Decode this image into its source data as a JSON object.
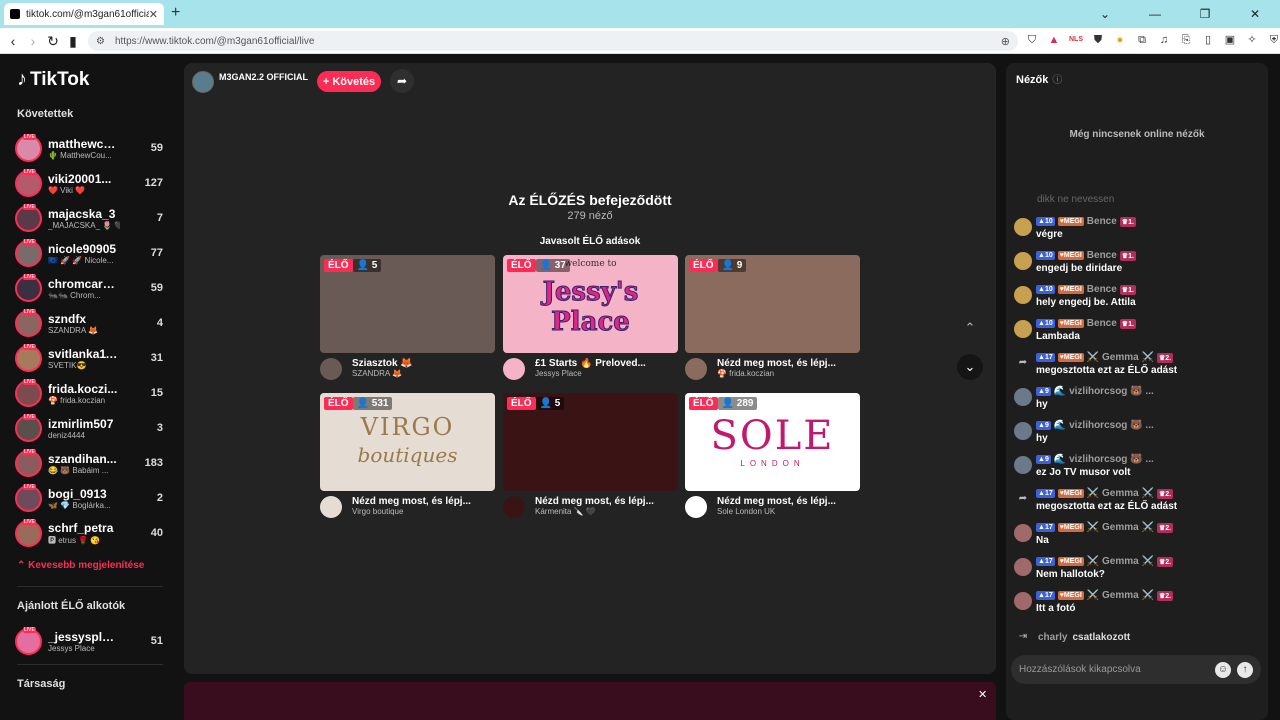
{
  "browser": {
    "tab_title": "tiktok.com/@m3gan61official/li...",
    "url": "https://www.tiktok.com/@m3gan61official/live"
  },
  "brand": {
    "name": "TikTok"
  },
  "sidebar": {
    "following_title": "Követettek",
    "accounts": [
      {
        "name": "matthewco...",
        "sub": "🌵 MatthewCou...",
        "count": "59"
      },
      {
        "name": "viki20001...",
        "sub": "❤️ Viki ❤️",
        "count": "127"
      },
      {
        "name": "majacska_3",
        "sub": "_MAJACSKA_ 🌷 🖤",
        "count": "7"
      },
      {
        "name": "nicole90905",
        "sub": "🇪🇺 🚀 🚀 Nicole...",
        "count": "77"
      },
      {
        "name": "chromcarb...",
        "sub": "🐜🐜 Chrom...",
        "count": "59"
      },
      {
        "name": "szndfx",
        "sub": "SZANDRA 🦊",
        "count": "4"
      },
      {
        "name": "svitlanka11...",
        "sub": "SVETIK😎",
        "count": "31"
      },
      {
        "name": "frida.koczi...",
        "sub": "🍄 frida.koczian",
        "count": "15"
      },
      {
        "name": "izmirlim507",
        "sub": "deniz4444",
        "count": "3"
      },
      {
        "name": "szandihan...",
        "sub": "😂 🐻 Babáim ...",
        "count": "183"
      },
      {
        "name": "bogi_0913",
        "sub": "🦋 💎 Boglárka...",
        "count": "2"
      },
      {
        "name": "schrf_petra",
        "sub": "🅿 etrus 🌹 😘",
        "count": "40"
      }
    ],
    "show_less": "Kevesebb megjelenítése",
    "recommended_title": "Ajánlott ÉLŐ alkotók",
    "recommended": [
      {
        "name": "_jessysplace",
        "sub": "Jessys Place",
        "count": "51"
      }
    ],
    "company_title": "Társaság"
  },
  "stage": {
    "host_name": "M3GAN2.2 OFFICIAL",
    "follow_label": "+ Követés",
    "ended_title": "Az ÉLŐZÉS befejeződött",
    "ended_viewers": "279 néző",
    "suggested_title": "Javasolt ÉLŐ adások",
    "live_label": "ÉLŐ",
    "cards": [
      {
        "count": "5",
        "title": "Sziasztok 🦊",
        "user": "SZANDRA 🦊",
        "thumb_color": "#6a5a56"
      },
      {
        "count": "37",
        "title": "£1 Starts 🔥 Preloved...",
        "user": "Jessys Place",
        "thumb_color": "#f4b3c6"
      },
      {
        "count": "9",
        "title": "Nézd meg most, és lépj...",
        "user": "🍄 frida.koczian",
        "thumb_color": "#8a6b5e"
      },
      {
        "count": "531",
        "title": "Nézd meg most, és lépj...",
        "user": "Virgo boutique",
        "thumb_color": "#e5ddd3"
      },
      {
        "count": "5",
        "title": "Nézd meg most, és lépj...",
        "user": "Kármenita 🔪 🖤",
        "thumb_color": "#3a1414"
      },
      {
        "count": "289",
        "title": "Nézd meg most, és lépj...",
        "user": "Sole London UK",
        "thumb_color": "#ffffff"
      }
    ],
    "card_logos": {
      "jessy": "Jessy's Place",
      "jessy_top": "welcome to",
      "virgo": "VIRGO",
      "virgo_sub": "boutiques",
      "sole": "SOLE",
      "sole_sub": "LONDON"
    }
  },
  "chat": {
    "title": "Nézők",
    "no_viewers": "Még nincsenek online nézők",
    "faded_msg": "dikk ne nevessen",
    "messages": [
      {
        "level": "10",
        "sub": "MEGI",
        "name": "Bence",
        "rank": "1.",
        "text": "végre"
      },
      {
        "level": "10",
        "sub": "MEGI",
        "name": "Bence",
        "rank": "1.",
        "text": "engedj be diridare"
      },
      {
        "level": "10",
        "sub": "MEGI",
        "name": "Bence",
        "rank": "1.",
        "text": "hely engedj be. Attila"
      },
      {
        "level": "10",
        "sub": "MEGI",
        "name": "Bence",
        "rank": "1.",
        "text": "Lambada"
      },
      {
        "level": "17",
        "sub": "MEGI",
        "name": "⚔️ Gemma ⚔️",
        "rank": "2.",
        "text": "megosztotta ezt az ÉLŐ adást"
      },
      {
        "level": "9",
        "sub": "",
        "name": "🌊 vizlihorcsog 🐻 ...",
        "rank": "",
        "text": "hy"
      },
      {
        "level": "9",
        "sub": "",
        "name": "🌊 vizlihorcsog 🐻 ...",
        "rank": "",
        "text": "hy"
      },
      {
        "level": "9",
        "sub": "",
        "name": "🌊 vizlihorcsog 🐻 ...",
        "rank": "",
        "text": "ez Jo TV musor volt"
      },
      {
        "level": "17",
        "sub": "MEGI",
        "name": "⚔️ Gemma ⚔️",
        "rank": "2.",
        "text": "megosztotta ezt az ÉLŐ adást"
      },
      {
        "level": "17",
        "sub": "MEGI",
        "name": "⚔️ Gemma ⚔️",
        "rank": "2.",
        "text": "Na"
      },
      {
        "level": "17",
        "sub": "MEGI",
        "name": "⚔️ Gemma ⚔️",
        "rank": "2.",
        "text": "Nem hallotok?"
      },
      {
        "level": "17",
        "sub": "MEGI",
        "name": "⚔️ Gemma ⚔️",
        "rank": "2.",
        "text": "Itt a fotó"
      }
    ],
    "join_name": "charly",
    "join_text": "csatlakozott",
    "comment_placeholder": "Hozzászólások kikapcsolva"
  }
}
